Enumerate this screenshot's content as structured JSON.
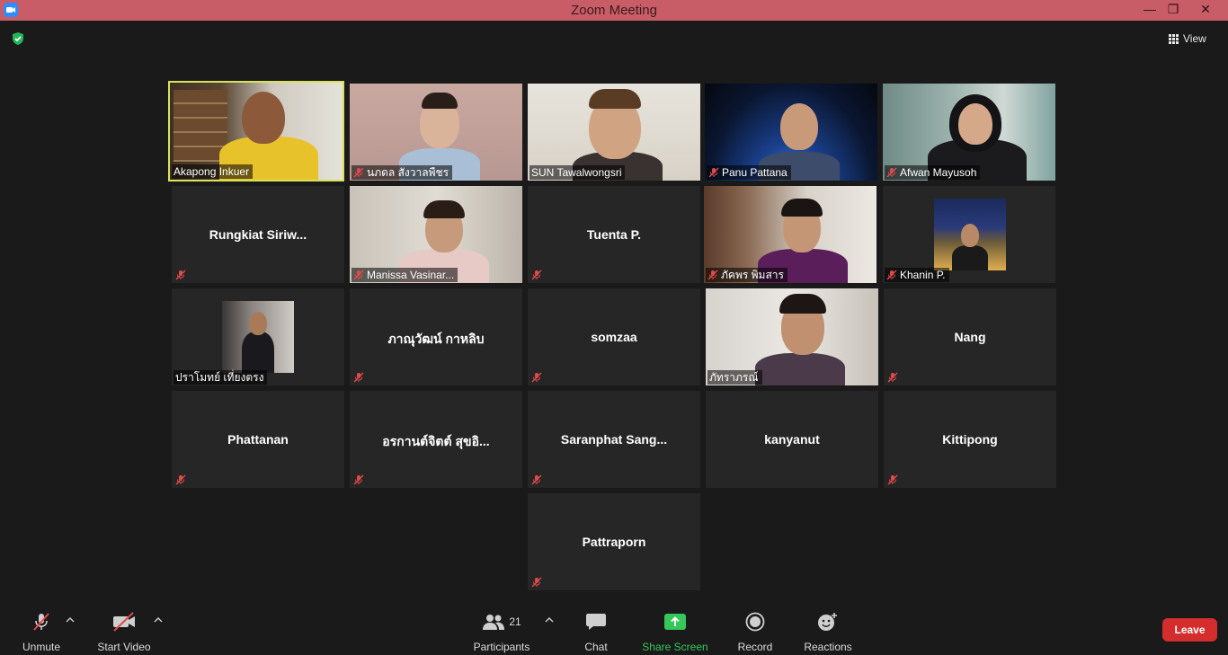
{
  "window": {
    "title": "Zoom Meeting",
    "minimize": "—",
    "maximize": "❐",
    "close": "✕"
  },
  "view": {
    "label": "View"
  },
  "tiles": [
    {
      "name": "Akapong Inkuer",
      "video": true,
      "active": true,
      "muted": false
    },
    {
      "name": "นภดล สังวาลพืชร",
      "video": true,
      "muted": true
    },
    {
      "name": "SUN Tawalwongsri",
      "video": true,
      "muted": false
    },
    {
      "name": "Panu Pattana",
      "video": true,
      "muted": true
    },
    {
      "name": "Afwan Mayusoh",
      "video": true,
      "muted": true
    },
    {
      "name": "Rungkiat   Siriw...",
      "video": false,
      "muted": true
    },
    {
      "name": "Manissa Vasinar...",
      "video": true,
      "muted": true
    },
    {
      "name": "Tuenta P.",
      "video": false,
      "muted": true
    },
    {
      "name": "ภัคพร พิมสาร",
      "video": true,
      "muted": true
    },
    {
      "name": "Khanin P.",
      "video": false,
      "thumb": true,
      "muted": true
    },
    {
      "name": "ปราโมทย์ เที่ยงตรง",
      "video": false,
      "thumb": true,
      "muted": false
    },
    {
      "name": "ภาณุวัฒน์ กาหลิบ",
      "video": false,
      "muted": true
    },
    {
      "name": "somzaa",
      "video": false,
      "muted": true
    },
    {
      "name": "ภัทราภรณ์",
      "video": true,
      "muted": false
    },
    {
      "name": "Nang",
      "video": false,
      "muted": true
    },
    {
      "name": "Phattanan",
      "video": false,
      "muted": true
    },
    {
      "name": "อรกานต์จิตต์ สุขอิ...",
      "video": false,
      "muted": true
    },
    {
      "name": "Saranphat  Sang...",
      "video": false,
      "muted": true
    },
    {
      "name": "kanyanut",
      "video": false,
      "muted": false
    },
    {
      "name": "Kittipong",
      "video": false,
      "muted": true
    },
    {
      "name": "Pattraporn",
      "video": false,
      "muted": true
    }
  ],
  "toolbar": {
    "unmute": "Unmute",
    "start_video": "Start Video",
    "participants": "Participants",
    "participants_count": "21",
    "chat": "Chat",
    "share_screen": "Share Screen",
    "record": "Record",
    "reactions": "Reactions",
    "leave": "Leave"
  },
  "colors": {
    "titlebar": "#c95d67",
    "active_speaker": "#d8e35d",
    "share": "#34c759",
    "leave": "#d32d2d",
    "mute_icon": "#e04a4a"
  }
}
